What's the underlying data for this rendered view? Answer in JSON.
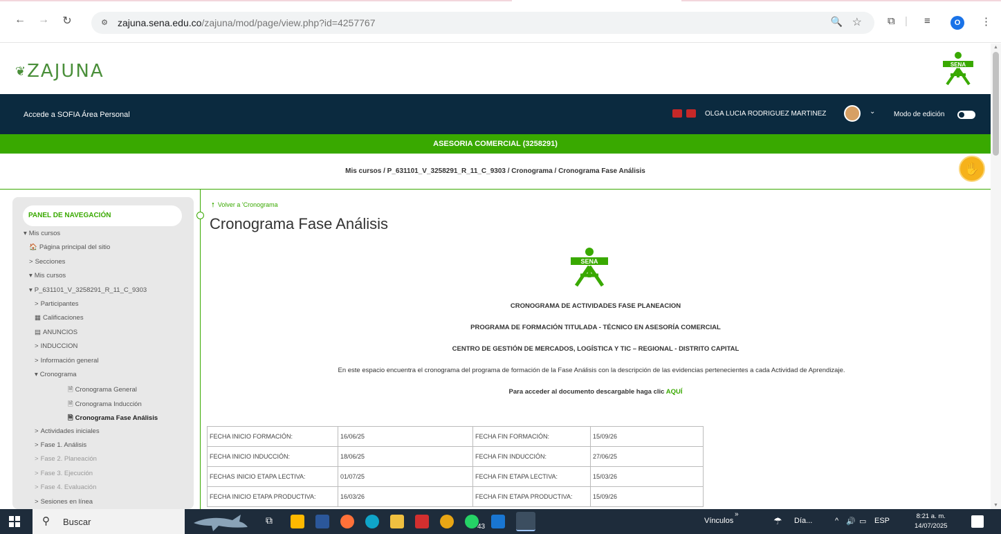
{
  "browser": {
    "url_domain": "zajuna.sena.edu.co",
    "url_path": "/zajuna/mod/page/view.php?id=4257767",
    "profile_letter": "O"
  },
  "site": {
    "logo_text": "ZAJUNA",
    "nav_links": [
      "Accede a SOFIA",
      "Área Personal"
    ],
    "user_name": "OLGA LUCIA RODRIGUEZ MARTINEZ",
    "edit_mode_label": "Modo de edición",
    "course_title": "ASESORIA COMERCIAL (3258291)",
    "breadcrumb": "Mis cursos / P_631101_V_3258291_R_11_C_9303 / Cronograma / Cronograma Fase Análisis"
  },
  "sidebar": {
    "title": "PANEL DE NAVEGACIÓN",
    "items": [
      {
        "label": "Mis cursos",
        "prefix": "▾",
        "level": 0
      },
      {
        "label": "Página principal del sitio",
        "prefix": "🏠",
        "level": 1
      },
      {
        "label": "Secciones",
        "prefix": ">",
        "level": 1
      },
      {
        "label": "Mis cursos",
        "prefix": "▾",
        "level": 1
      },
      {
        "label": "P_631101_V_3258291_R_11_C_9303",
        "prefix": "▾",
        "level": 2
      },
      {
        "label": "Participantes",
        "prefix": ">",
        "level": 3
      },
      {
        "label": "Calificaciones",
        "prefix": "▦",
        "level": 3
      },
      {
        "label": "ANUNCIOS",
        "prefix": "▤",
        "level": 3
      },
      {
        "label": "INDUCCION",
        "prefix": ">",
        "level": 3
      },
      {
        "label": "Información general",
        "prefix": ">",
        "level": 3
      },
      {
        "label": "Cronograma",
        "prefix": "▾",
        "level": 3
      },
      {
        "label": "Cronograma General",
        "prefix": "🗎",
        "level": 4
      },
      {
        "label": "Cronograma Inducción",
        "prefix": "🗎",
        "level": 4
      },
      {
        "label": "Cronograma Fase Análisis",
        "prefix": "🗎",
        "level": 4
      },
      {
        "label": "Actividades iniciales",
        "prefix": ">",
        "level": 3
      },
      {
        "label": "Fase 1. Análisis",
        "prefix": ">",
        "level": 3
      },
      {
        "label": "Fase 2. Planeación",
        "prefix": ">",
        "level": 3
      },
      {
        "label": "Fase 3. Ejecución",
        "prefix": ">",
        "level": 3
      },
      {
        "label": "Fase 4. Evaluación",
        "prefix": ">",
        "level": 3
      },
      {
        "label": "Sesiones en línea",
        "prefix": ">",
        "level": 3
      }
    ]
  },
  "content": {
    "back_link": "Volver a 'Cronograma",
    "page_title": "Cronograma Fase Análisis",
    "logo_text": "SENA",
    "heading1": "CRONOGRAMA  DE ACTIVIDADES FASE PLANEACION",
    "heading2": "PROGRAMA DE FORMACIÓN TITULADA - TÉCNICO EN ASESORÍA COMERCIAL",
    "heading3": "CENTRO DE GESTIÓN DE MERCADOS, LOGÍSTICA Y TIC – REGIONAL - DISTRITO CAPITAL",
    "description": "En este espacio encuentra el cronograma del programa de formación de la Fase Análisis con la descripción de las evidencias pertenecientes a cada Actividad de Aprendizaje.",
    "download_text": "Para acceder al documento descargable haga clic",
    "download_link": "AQUÍ",
    "schedule": [
      [
        "FECHA INICIO FORMACIÓN:",
        "16/06/25",
        "FECHA FIN FORMACIÓN:",
        "15/09/26"
      ],
      [
        "FECHA INICIO INDUCCIÓN:",
        "18/06/25",
        "FECHA FIN INDUCCIÓN:",
        "27/06/25"
      ],
      [
        "FECHAS INICIO ETAPA LECTIVA:",
        "01/07/25",
        "FECHA FIN ETAPA LECTIVA:",
        "15/03/26"
      ],
      [
        "FECHA INICIO ETAPA PRODUCTIVA:",
        "16/03/26",
        "FECHA FIN ETAPA PRODUCTIVA:",
        "15/09/26"
      ]
    ]
  },
  "taskbar": {
    "search_placeholder": "Buscar",
    "whatsapp_badge": "43",
    "vinculos_label": "Vínculos",
    "weather_label": "Día...",
    "language": "ESP",
    "time": "8:21 a. m.",
    "date": "14/07/2025"
  },
  "colors": {
    "sena_green": "#39a900",
    "navy": "#0b2a3f",
    "taskbar": "#1e2c3b"
  }
}
